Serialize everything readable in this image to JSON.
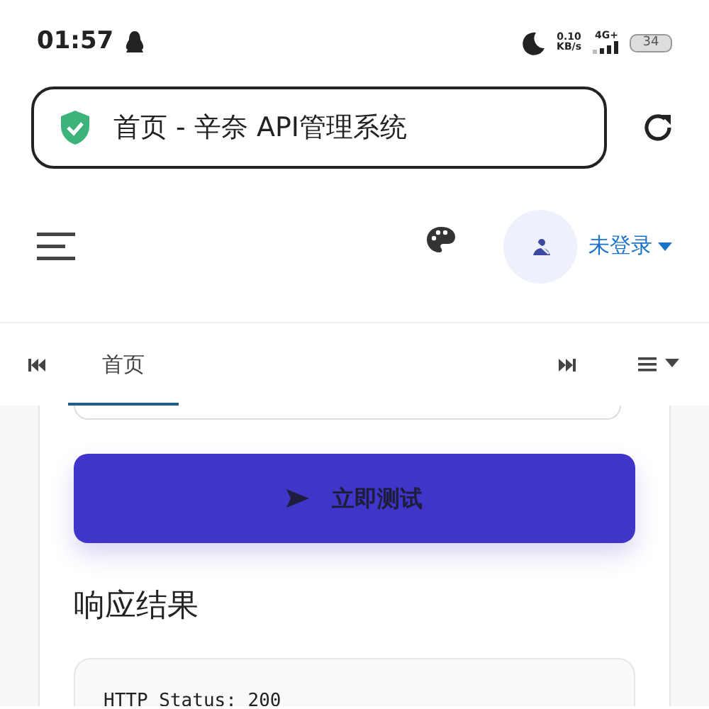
{
  "status_bar": {
    "time": "01:57",
    "net_speed": "0.10",
    "net_unit": "KB/s",
    "network": "4G+",
    "battery": "34"
  },
  "address_bar": {
    "title": "首页 - 辛奈 API管理系统",
    "secure": true
  },
  "navbar": {
    "user": "未登录"
  },
  "tabs": [
    {
      "label": "首页",
      "selected": true
    }
  ],
  "form": {
    "submit": "立即测试"
  },
  "response": {
    "heading": "响应结果",
    "lines": [
      "HTTP Status: 200"
    ]
  }
}
